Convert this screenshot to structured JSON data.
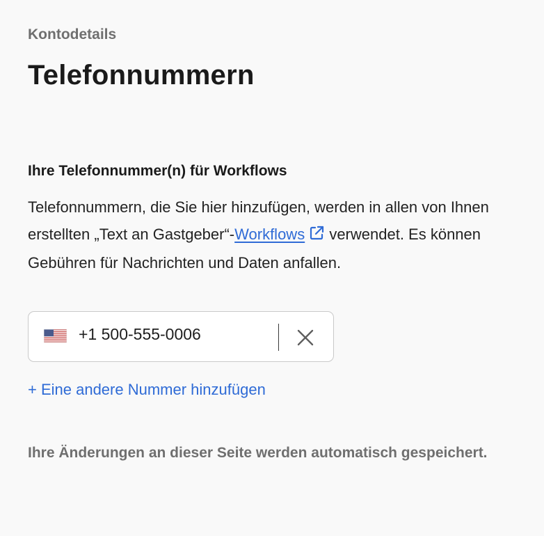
{
  "header": {
    "breadcrumb": "Kontodetails",
    "title": "Telefonnummern"
  },
  "section": {
    "heading": "Ihre Telefonnummer(n) für Workflows",
    "description_before": "Telefonnummern, die Sie hier hinzufügen, werden in allen von Ihnen erstellten „Text an Gastgeber“-",
    "workflows_link": "Workflows",
    "description_after": " verwendet. Es können Gebühren für Nachrichten und Daten anfallen."
  },
  "phone_field": {
    "country_flag": "us-flag-icon",
    "value": "+1 500-555-0006",
    "clear_icon": "close-icon"
  },
  "add_number_link": "+ Eine andere Nummer hinzufügen",
  "autosave_note": "Ihre Änderungen an dieser Seite werden automatisch gespeichert.",
  "colors": {
    "background": "#f9f9f9",
    "link": "#2f6bd6",
    "muted_text": "#6f6f6f",
    "text": "#1a1a1a"
  }
}
